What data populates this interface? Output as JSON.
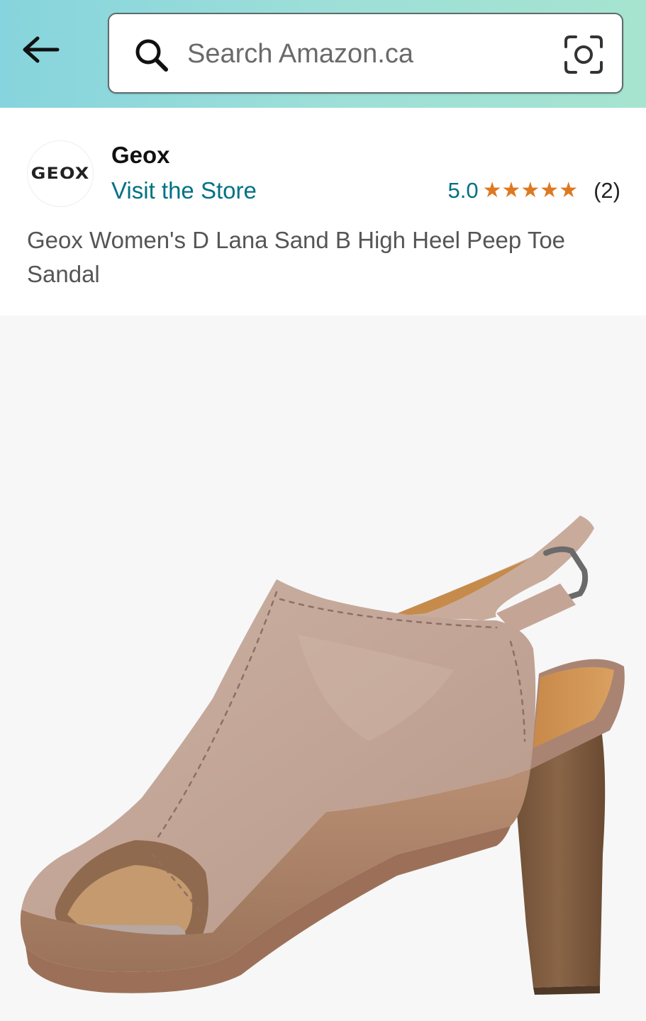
{
  "header": {
    "back_icon": "arrow-left-icon",
    "search": {
      "placeholder": "Search Amazon.ca",
      "value": "",
      "icon": "search-icon",
      "camera_icon": "camera-lens-icon"
    },
    "colors": {
      "gradient_start": "#86d4dd",
      "gradient_end": "#a6e4d0"
    }
  },
  "store": {
    "logo_text": "GEOX",
    "brand": "Geox",
    "visit_label": "Visit the Store",
    "rating": "5.0",
    "stars": 5,
    "review_count": "(2)",
    "link_color": "#007185",
    "star_color": "#de7921"
  },
  "product": {
    "title": "Geox Women's D Lana Sand B High Heel Peep Toe Sandal",
    "image_icon": "sandal-product-image"
  }
}
